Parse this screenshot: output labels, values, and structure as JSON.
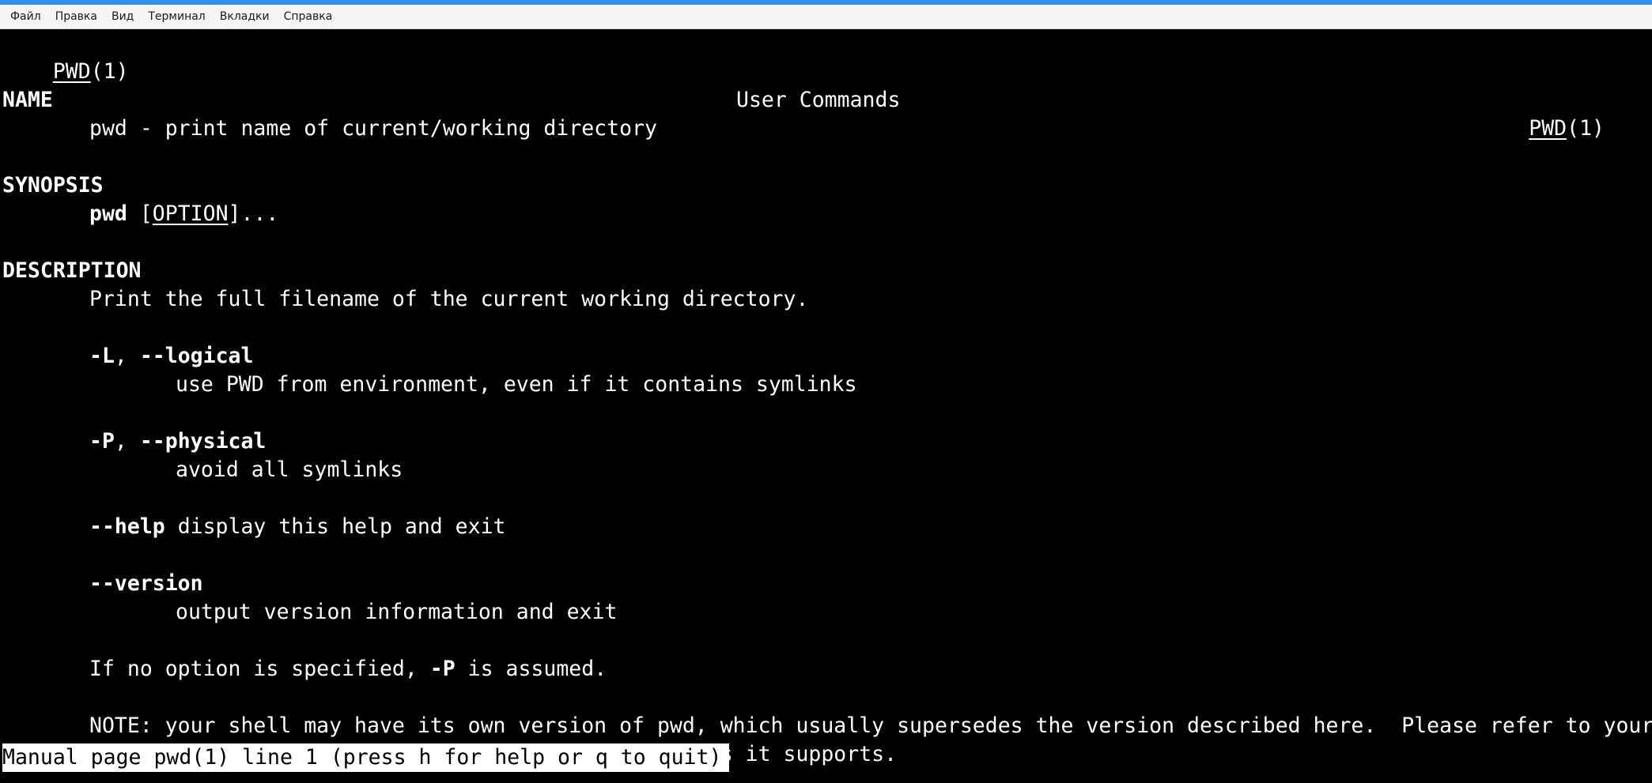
{
  "menubar": {
    "items": [
      "Файл",
      "Правка",
      "Вид",
      "Терминал",
      "Вкладки",
      "Справка"
    ]
  },
  "man": {
    "header_left_name": "PWD",
    "header_left_section": "(1)",
    "header_center": "User Commands",
    "header_right_name": "PWD",
    "header_right_section": "(1)",
    "name_heading": "NAME",
    "name_text": "pwd - print name of current/working directory",
    "synopsis_heading": "SYNOPSIS",
    "synopsis_cmd": "pwd",
    "synopsis_bracket_open": " [",
    "synopsis_option": "OPTION",
    "synopsis_bracket_close": "]...",
    "description_heading": "DESCRIPTION",
    "description_text": "Print the full filename of the current working directory.",
    "opt_L_short": "-L",
    "opt_sep1": ", ",
    "opt_L_long": "--logical",
    "opt_L_desc": "use PWD from environment, even if it contains symlinks",
    "opt_P_short": "-P",
    "opt_sep2": ", ",
    "opt_P_long": "--physical",
    "opt_P_desc": "avoid all symlinks",
    "opt_help": "--help",
    "opt_help_desc": " display this help and exit",
    "opt_version": "--version",
    "opt_version_desc": "output version information and exit",
    "default_pre": "If no option is specified, ",
    "default_opt": "-P",
    "default_post": " is assumed.",
    "note_line1": "NOTE: your shell may have its own version of pwd, which usually supersedes the version described here.  Please refer to your",
    "note_line2": "shell's documentation for details about the options it supports."
  },
  "status_bar": "Manual page pwd(1) line 1 (press h for help or q to quit)"
}
